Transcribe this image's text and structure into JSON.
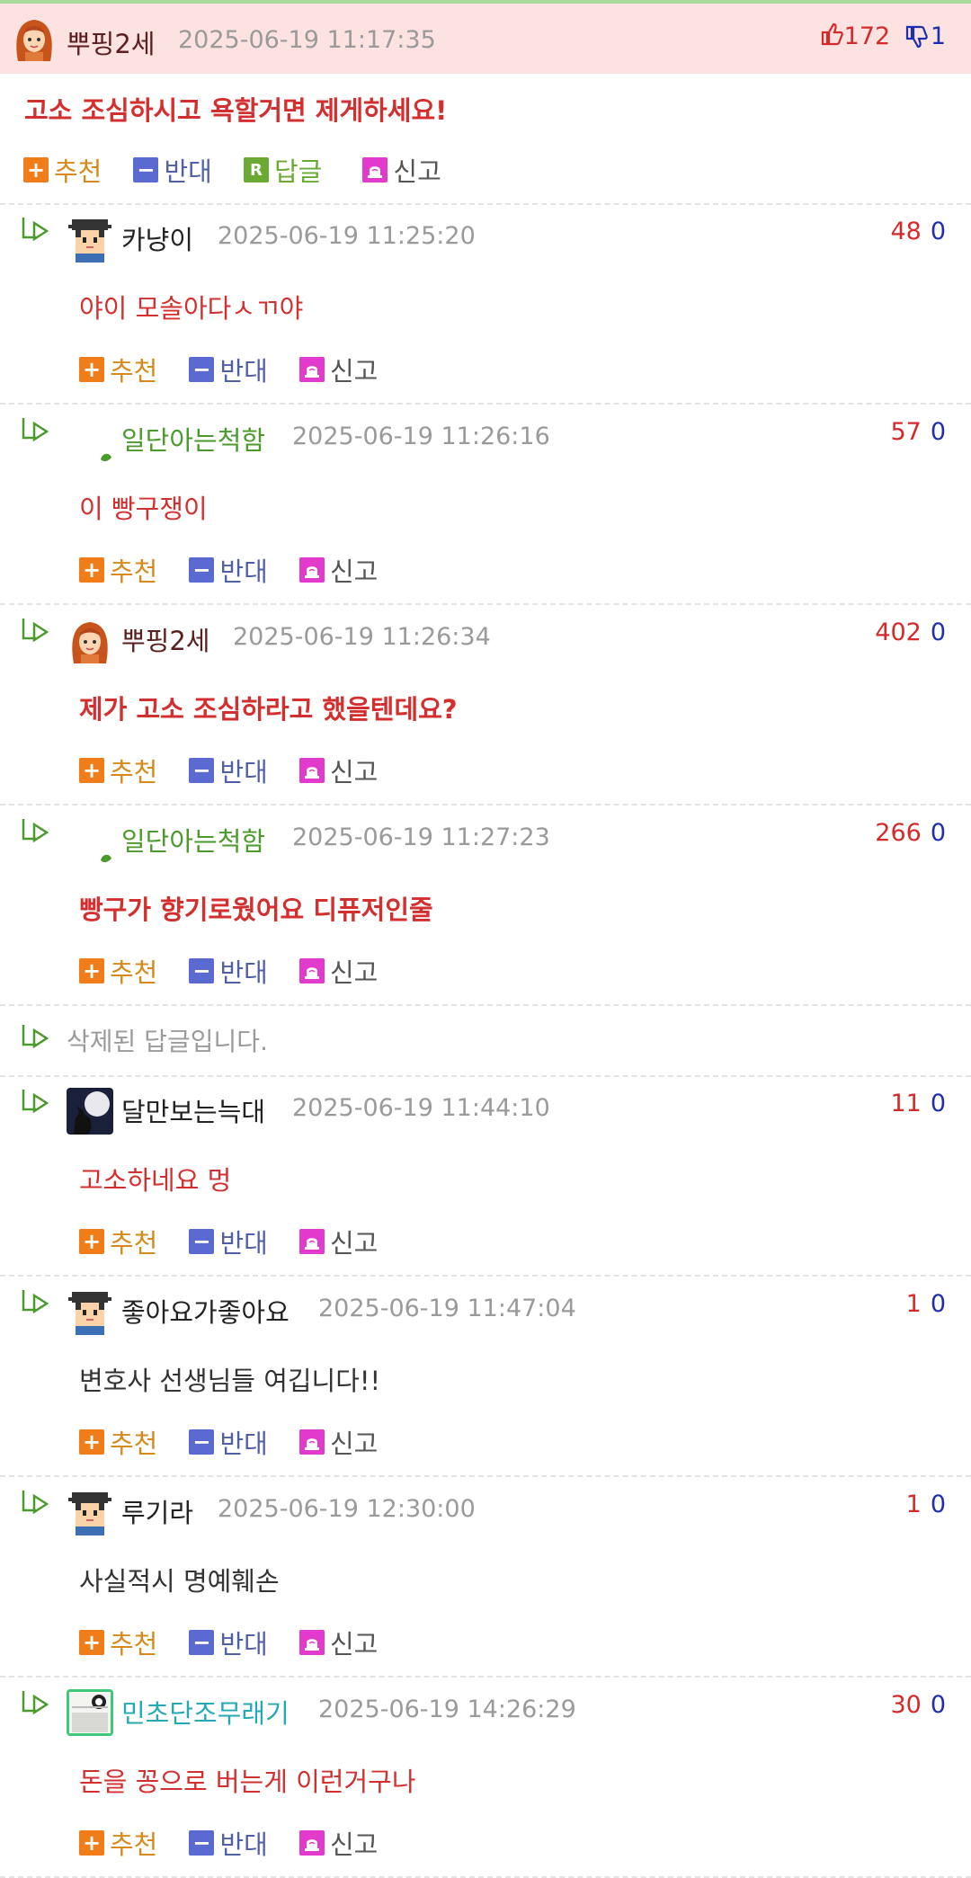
{
  "main": {
    "nick": "뿌핑2세",
    "date": "2025-06-19 11:17:35",
    "up": "172",
    "down": "1",
    "text": "고소 조심하시고 욕할거면 제게하세요!",
    "actions": {
      "recommend": "추천",
      "oppose": "반대",
      "reply": "답글",
      "report": "신고"
    }
  },
  "replies": [
    {
      "nick": "카냥이",
      "date": "2025-06-19 11:25:20",
      "up": "48",
      "down": "0",
      "text": "야이 모솔아다ㅅㄲ야",
      "avatar": "pixel-boy-avatar"
    },
    {
      "nick": "일단아는척함",
      "date": "2025-06-19 11:26:16",
      "up": "57",
      "down": "0",
      "text": "이 빵구쟁이",
      "avatar": "leaf-avatar"
    },
    {
      "nick": "뿌핑2세",
      "date": "2025-06-19 11:26:34",
      "up": "402",
      "down": "0",
      "text": "제가 고소 조심하라고 했을텐데요?",
      "avatar": "girl-avatar"
    },
    {
      "nick": "일단아는척함",
      "date": "2025-06-19 11:27:23",
      "up": "266",
      "down": "0",
      "text": "빵구가 향기로웠어요 디퓨저인줄",
      "avatar": "leaf-avatar"
    },
    {
      "nick": "달만보는늑대",
      "date": "2025-06-19 11:44:10",
      "up": "11",
      "down": "0",
      "text": "고소하네요 멍",
      "avatar": "wolf-moon-avatar"
    },
    {
      "nick": "좋아요가좋아요",
      "date": "2025-06-19 11:47:04",
      "up": "1",
      "down": "0",
      "text": "변호사 선생님들 여깁니다!!",
      "avatar": "pixel-boy-avatar"
    },
    {
      "nick": "루기라",
      "date": "2025-06-19 12:30:00",
      "up": "1",
      "down": "0",
      "text": "사실적시 명예훼손",
      "avatar": "pixel-boy-avatar"
    },
    {
      "nick": "민초단조무래기",
      "date": "2025-06-19 14:26:29",
      "up": "30",
      "down": "0",
      "text": "돈을 꽁으로 버는게 이런거구나",
      "avatar": "mint-avatar"
    }
  ],
  "deleted_text": "삭제된 답글입니다.",
  "reply_actions": {
    "recommend": "추천",
    "oppose": "반대",
    "report": "신고"
  },
  "icons": {
    "thumbs_up": "thumbs-up-icon",
    "thumbs_down": "thumbs-down-icon",
    "reply_arrow": "reply-arrow-icon",
    "plus": "plus-icon",
    "minus": "minus-icon",
    "reply_r": "reply-icon",
    "report": "siren-icon"
  },
  "colors": {
    "header_bg": "#fde2e2",
    "up": "#d42a2a",
    "down": "#1e2fae",
    "comment_red": "#d32f2f",
    "nick_green": "#4a9a2c",
    "nick_teal": "#24aab5"
  }
}
